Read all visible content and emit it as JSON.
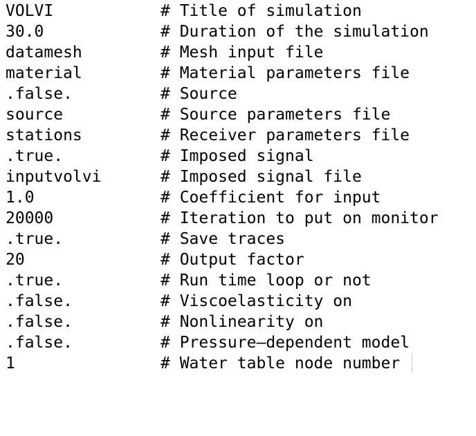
{
  "lines": [
    {
      "value": "VOLVI",
      "comment": "# Title of simulation"
    },
    {
      "value": "30.0",
      "comment": "# Duration of the simulation"
    },
    {
      "value": "datamesh",
      "comment": "# Mesh input file"
    },
    {
      "value": "material",
      "comment": "# Material parameters file"
    },
    {
      "value": ".false.",
      "comment": "# Source"
    },
    {
      "value": "source",
      "comment": "# Source parameters file"
    },
    {
      "value": "stations",
      "comment": "# Receiver parameters file"
    },
    {
      "value": ".true.",
      "comment": "# Imposed signal"
    },
    {
      "value": "inputvolvi",
      "comment": "# Imposed signal file"
    },
    {
      "value": "1.0",
      "comment": "# Coefficient for input"
    },
    {
      "value": "20000",
      "comment": "# Iteration to put on monitor"
    },
    {
      "value": ".true.",
      "comment": "# Save traces"
    },
    {
      "value": "20",
      "comment": "# Output factor"
    },
    {
      "value": ".true.",
      "comment": "# Run time loop or not"
    },
    {
      "value": ".false.",
      "comment": "# Viscoelasticity on"
    },
    {
      "value": ".false.",
      "comment": "# Nonlinearity on"
    },
    {
      "value": ".false.",
      "comment": "# Pressure–dependent model"
    },
    {
      "value": "1",
      "comment": "# Water table node number"
    }
  ]
}
